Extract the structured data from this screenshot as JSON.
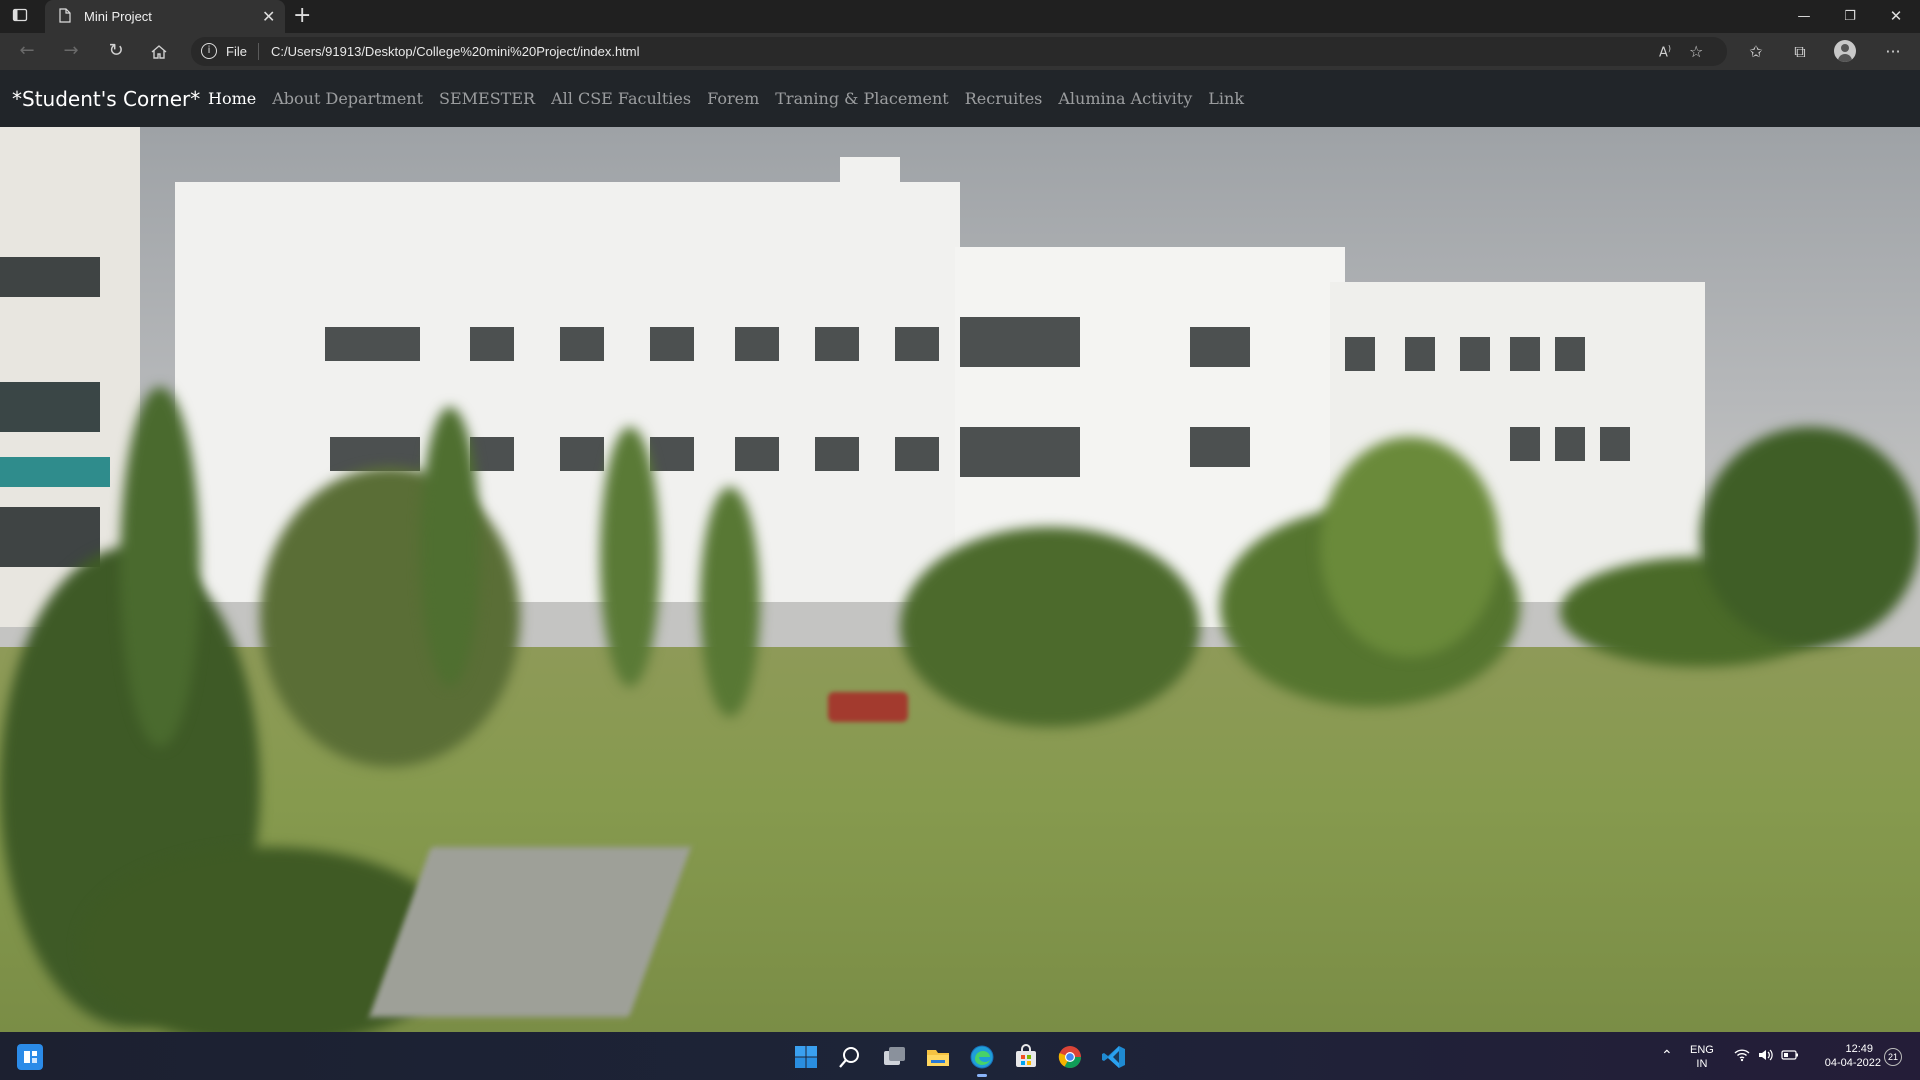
{
  "browser": {
    "tab_title": "Mini Project",
    "new_tab_glyph": "+",
    "close_glyph": "✕",
    "scheme_label": "File",
    "url": "C:/Users/91913/Desktop/College%20mini%20Project/index.html",
    "icons": [
      "back-icon",
      "forward-icon",
      "refresh-icon",
      "home-icon",
      "info-icon",
      "read-aloud-icon",
      "favorite-add-icon",
      "favorites-icon",
      "collections-icon",
      "profile-icon",
      "more-icon"
    ]
  },
  "site": {
    "brand": "*Student's Corner*",
    "nav": [
      {
        "label": "Home",
        "active": true
      },
      {
        "label": "About Department"
      },
      {
        "label": "SEMESTER"
      },
      {
        "label": "All CSE Faculties"
      },
      {
        "label": "Forem"
      },
      {
        "label": "Traning & Placement"
      },
      {
        "label": "Recruites"
      },
      {
        "label": "Alumina Activity"
      },
      {
        "label": "Link"
      }
    ],
    "hero_image": "college-campus-building-photo"
  },
  "taskbar": {
    "icons": [
      "widgets-icon",
      "start-icon",
      "search-icon",
      "task-view-icon",
      "file-explorer-icon",
      "edge-icon",
      "store-icon",
      "chrome-icon",
      "vscode-icon"
    ],
    "lang_line1": "ENG",
    "lang_line2": "IN",
    "time": "12:49",
    "date": "04-04-2022",
    "notifications": "21"
  },
  "colors": {
    "nav_bg": "#212529",
    "nav_active": "#ffffff",
    "nav_inactive": "rgba(255,255,255,0.55)"
  }
}
